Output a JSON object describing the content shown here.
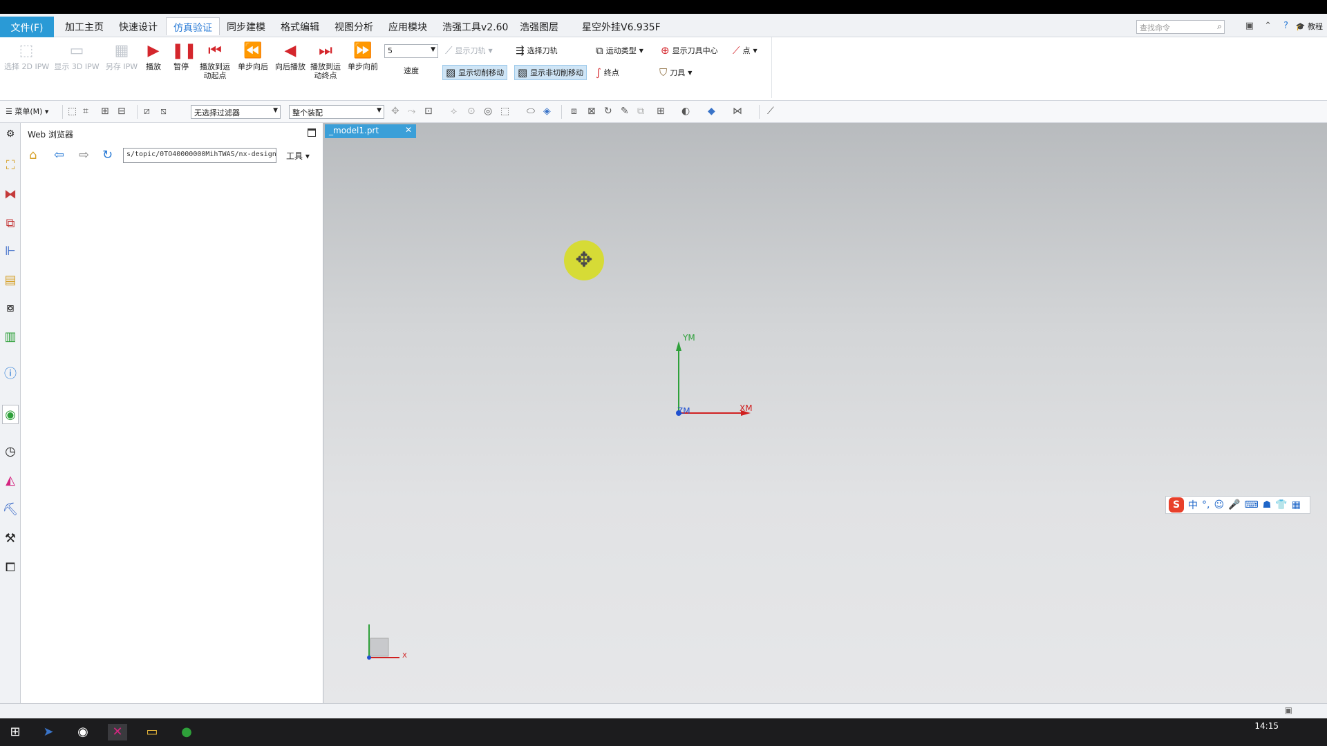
{
  "menubar": {
    "tabs": [
      {
        "label": "文件(F)",
        "type": "file"
      },
      {
        "label": "加工主页"
      },
      {
        "label": "快速设计"
      },
      {
        "label": "仿真验证",
        "active": true
      },
      {
        "label": "同步建模"
      },
      {
        "label": "格式编辑"
      },
      {
        "label": "视图分析"
      },
      {
        "label": "应用模块"
      },
      {
        "label": "浩强工具v2.60"
      },
      {
        "label": "浩强图层"
      },
      {
        "label": "星空外挂V6.935F"
      }
    ],
    "search_placeholder": "查找命令",
    "help_label": "教程"
  },
  "ribbon": {
    "buttons": [
      {
        "label": "选择 2D IPW",
        "icon": "ipw2d-icon",
        "disabled": true
      },
      {
        "label": "显示 3D IPW",
        "icon": "ipw3d-icon",
        "disabled": true
      },
      {
        "label": "另存 IPW",
        "icon": "save-ipw-icon",
        "disabled": true
      },
      {
        "label": "播放",
        "icon": "play-icon"
      },
      {
        "label": "暂停",
        "icon": "pause-icon"
      },
      {
        "label": "播放到运动起点",
        "icon": "rewind-start-icon"
      },
      {
        "label": "单步向后",
        "icon": "step-back-icon"
      },
      {
        "label": "向后播放",
        "icon": "reverse-play-icon"
      },
      {
        "label": "播放到运动终点",
        "icon": "forward-end-icon"
      },
      {
        "label": "单步向前",
        "icon": "step-forward-icon"
      }
    ],
    "speed_value": "5",
    "speed_label": "速度",
    "show_toolpath": "显示刀轨",
    "select_toolpath": "选择刀轨",
    "show_cut_moves": "显示切削移动",
    "show_noncut_moves": "显示非切削移动",
    "motion_type": "运动类型",
    "show_tool_center": "显示刀具中心",
    "point": "点",
    "endpoint": "终点",
    "tool": "刀具"
  },
  "toolbar2": {
    "menu_label": "菜单(M)",
    "filter_value": "无选择过滤器",
    "assembly_value": "整个装配"
  },
  "web_panel": {
    "title": "Web 浏览器",
    "url": "s/topic/0TO40000000MihTWAS/nx-design",
    "tools_label": "工具"
  },
  "document": {
    "tab_label": "_model1.prt"
  },
  "viewport": {
    "axis_y": "YM",
    "axis_x": "XM",
    "axis_z": "ZM",
    "triad_x": "X"
  },
  "ime": {
    "mode": "中"
  },
  "taskbar": {
    "clock": "14:15"
  },
  "colors": {
    "accent": "#2a9ad6",
    "tab_active_text": "#2a7bd6",
    "axis_y": "#2ea03a",
    "axis_x": "#d02020",
    "axis_z": "#2050d0",
    "cursor_highlight": "#d7dc2e"
  }
}
